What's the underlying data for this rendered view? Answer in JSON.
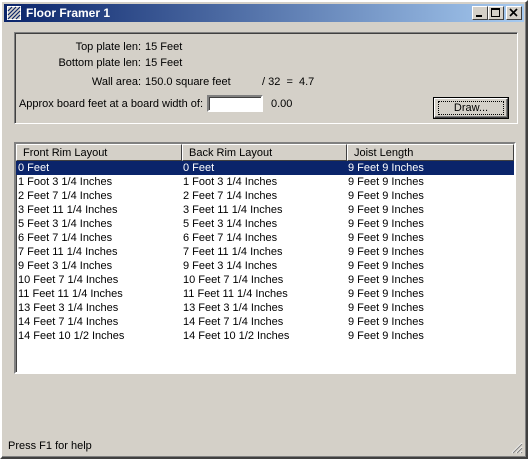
{
  "window": {
    "title": "Floor Framer 1"
  },
  "panel": {
    "top_plate_label": "Top plate len:",
    "top_plate_value": "15 Feet",
    "bottom_plate_label": "Bottom plate len:",
    "bottom_plate_value": "15 Feet",
    "wall_area_label": "Wall area:",
    "wall_area_value": "150.0 square feet",
    "ratio_text": "/ 32  =  4.7",
    "board_feet_label": "Approx board feet at a board width of:",
    "board_width_value": "",
    "board_feet_result": "0.00",
    "draw_button": "Draw..."
  },
  "list": {
    "columns": [
      "Front Rim Layout",
      "Back Rim Layout",
      "Joist Length"
    ],
    "selected_index": 0,
    "rows": [
      [
        "0 Feet",
        "0 Feet",
        "9 Feet 9 Inches"
      ],
      [
        "1 Foot 3 1/4 Inches",
        "1 Foot 3 1/4 Inches",
        "9 Feet 9 Inches"
      ],
      [
        "2 Feet 7 1/4 Inches",
        "2 Feet 7 1/4 Inches",
        "9 Feet 9 Inches"
      ],
      [
        "3 Feet 11 1/4 Inches",
        "3 Feet 11 1/4 Inches",
        "9 Feet 9 Inches"
      ],
      [
        "5 Feet 3 1/4 Inches",
        "5 Feet 3 1/4 Inches",
        "9 Feet 9 Inches"
      ],
      [
        "6 Feet 7 1/4 Inches",
        "6 Feet 7 1/4 Inches",
        "9 Feet 9 Inches"
      ],
      [
        "7 Feet 11 1/4 Inches",
        "7 Feet 11 1/4 Inches",
        "9 Feet 9 Inches"
      ],
      [
        "9 Feet 3 1/4 Inches",
        "9 Feet 3 1/4 Inches",
        "9 Feet 9 Inches"
      ],
      [
        "10 Feet 7 1/4 Inches",
        "10 Feet 7 1/4 Inches",
        "9 Feet 9 Inches"
      ],
      [
        "11 Feet 11 1/4 Inches",
        "11 Feet 11 1/4 Inches",
        "9 Feet 9 Inches"
      ],
      [
        "13 Feet 3 1/4 Inches",
        "13 Feet 3 1/4 Inches",
        "9 Feet 9 Inches"
      ],
      [
        "14 Feet 7 1/4 Inches",
        "14 Feet 7 1/4 Inches",
        "9 Feet 9 Inches"
      ],
      [
        "14 Feet 10 1/2 Inches",
        "14 Feet 10 1/2 Inches",
        "9 Feet 9 Inches"
      ]
    ]
  },
  "statusbar": {
    "text": "Press F1 for help"
  },
  "colors": {
    "selection": "#0a246a",
    "face": "#d4d0c8",
    "title_start": "#0a246a",
    "title_end": "#a6caf0"
  },
  "icons": {
    "app": "floor-framer-app-icon",
    "minimize": "minimize-icon",
    "maximize": "maximize-icon",
    "close": "close-icon",
    "grip": "size-grip-icon"
  }
}
